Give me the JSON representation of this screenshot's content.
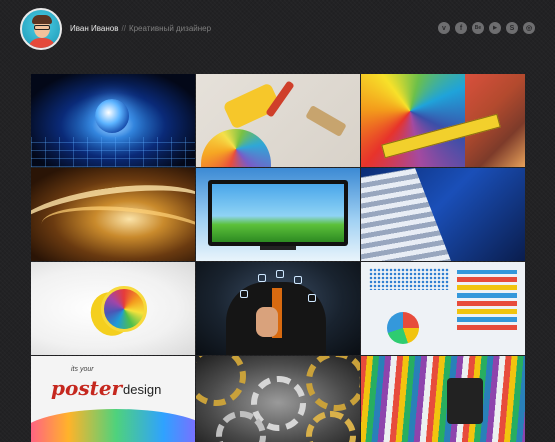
{
  "header": {
    "name": "Иван Иванов",
    "separator": "//",
    "role": "Креативный дизайнер"
  },
  "socials": [
    {
      "icon": "vimeo-icon",
      "glyph": "v"
    },
    {
      "icon": "facebook-icon",
      "glyph": "f"
    },
    {
      "icon": "behance-icon",
      "glyph": "Be"
    },
    {
      "icon": "youtube-icon",
      "glyph": "▶"
    },
    {
      "icon": "skype-icon",
      "glyph": "S"
    },
    {
      "icon": "instagram-icon",
      "glyph": "◎"
    }
  ],
  "gallery": {
    "poster_tile": {
      "line1": "its your",
      "line2": "poster",
      "line3": "design"
    }
  },
  "colors": {
    "background": "#222224",
    "name": "#e6e6e6",
    "role": "#7f7f7f",
    "social": "#6e6e70"
  }
}
